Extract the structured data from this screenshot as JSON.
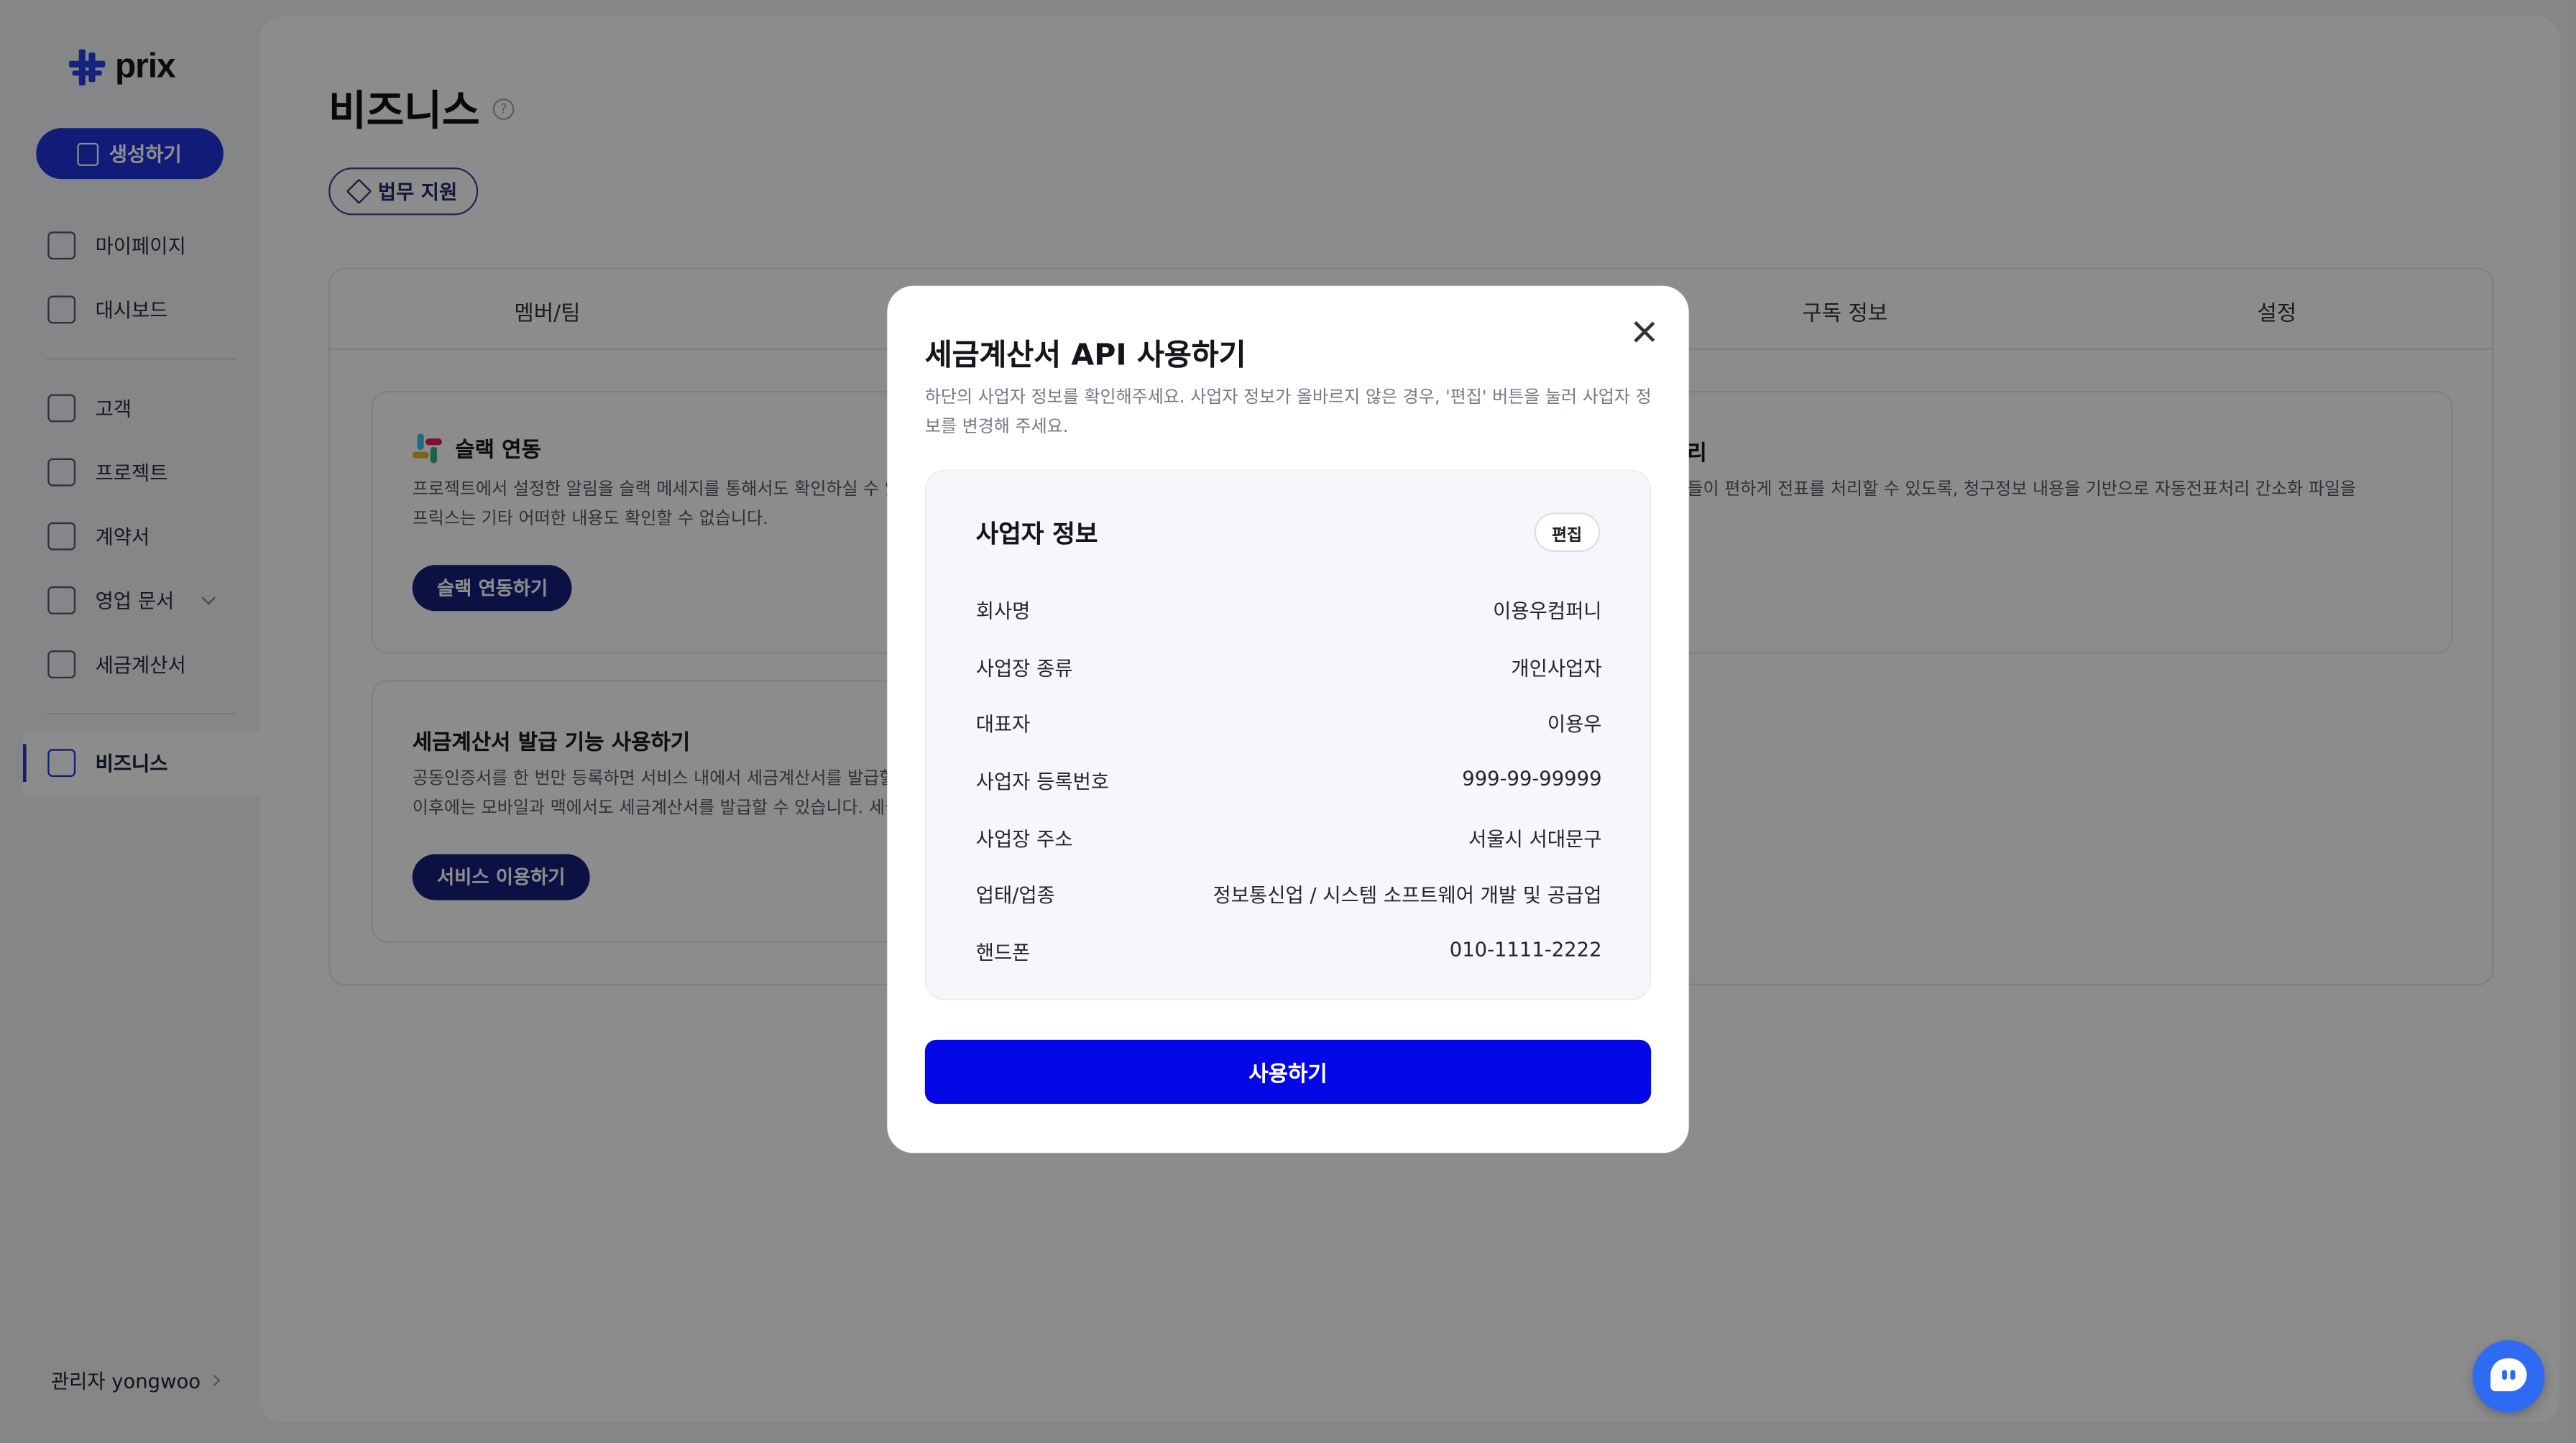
{
  "sidebar": {
    "logo_text": "prix",
    "create_label": "생성하기",
    "items": [
      {
        "label": "마이페이지"
      },
      {
        "label": "대시보드"
      },
      {
        "label": "고객"
      },
      {
        "label": "프로젝트"
      },
      {
        "label": "계약서"
      },
      {
        "label": "영업 문서"
      },
      {
        "label": "세금계산서"
      },
      {
        "label": "비즈니스"
      }
    ],
    "admin_label": "관리자 yongwoo"
  },
  "main": {
    "title": "비즈니스",
    "help_icon": "?",
    "legal_label": "법무 지원",
    "tabs": [
      "멤버/팀",
      "구독 정보",
      "설정"
    ],
    "cards": {
      "slack": {
        "title": "슬랙 연동",
        "desc_line1": "프로젝트에서 설정한 알림을 슬랙 메세지를 통해서도 확인하실 수 있",
        "desc_line2": "프릭스는 기타 어떠한 내용도 확인할 수 없습니다.",
        "button": "슬랙 연동하기"
      },
      "tax": {
        "title": "세금계산서 발급 기능 사용하기",
        "desc_line1": "공동인증서를 한 번만 등록하면 서비스 내에서 세금계산서를 발급할",
        "desc_line2": "이후에는 모바일과 맥에서도 세금계산서를 발급할 수 있습니다. 세금",
        "button": "서비스 이용하기"
      },
      "right": {
        "title_fragment": "리",
        "desc_fragment": "들이 편하게 전표를 처리할 수 있도록, 청구정보 내용을 기반으로 자동전표처리 간소화 파일을"
      }
    }
  },
  "modal": {
    "title": "세금계산서 API 사용하기",
    "description": "하단의 사업자 정보를 확인해주세요. 사업자 정보가 올바르지 않은 경우, '편집' 버튼을 눌러 사업자 정보를 변경해 주세요.",
    "info_title": "사업자 정보",
    "edit_label": "편집",
    "rows": [
      {
        "label": "회사명",
        "value": "이용우컴퍼니"
      },
      {
        "label": "사업장 종류",
        "value": "개인사업자"
      },
      {
        "label": "대표자",
        "value": "이용우"
      },
      {
        "label": "사업자 등록번호",
        "value": "999-99-99999"
      },
      {
        "label": "사업장 주소",
        "value": "서울시 서대문구"
      },
      {
        "label": "업태/업종",
        "value": "정보통신업 / 시스템 소프트웨어 개발 및 공급업"
      },
      {
        "label": "핸드폰",
        "value": "010-1111-2222"
      }
    ],
    "submit_label": "사용하기"
  },
  "colors": {
    "accent": "#1e33d9",
    "primary_button": "#0407e6",
    "dark_button": "#14207a",
    "chat_fab": "#2f6bf2"
  }
}
